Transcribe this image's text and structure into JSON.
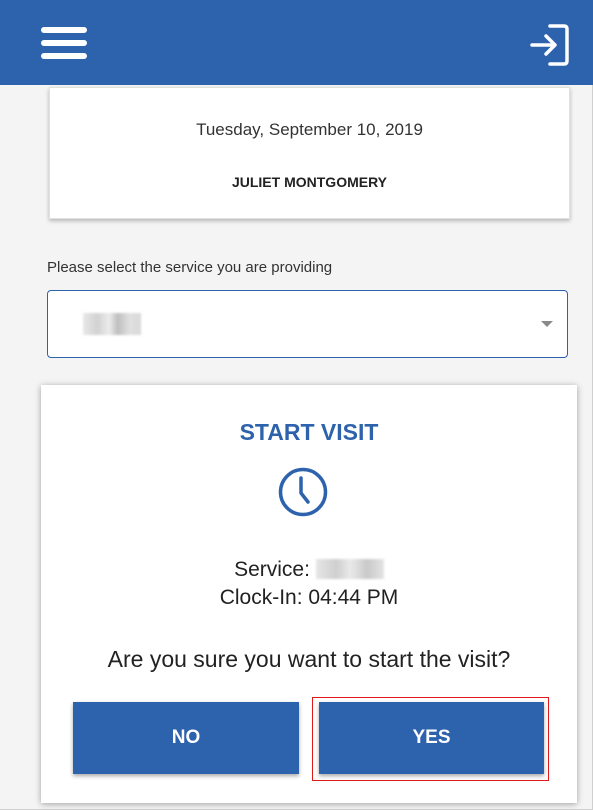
{
  "header": {
    "menu_icon": "hamburger-menu-icon",
    "logout_icon": "sign-out-icon",
    "background": "#2d62ad"
  },
  "visit_card": {
    "date": "Tuesday, September 10, 2019",
    "client_name": "JULIET MONTGOMERY"
  },
  "service_select": {
    "label": "Please select the service you are providing",
    "selected_value": "",
    "border_color": "#2d62ad"
  },
  "dialog": {
    "title": "START VISIT",
    "icon": "clock-icon",
    "service_label": "Service:",
    "service_value": "",
    "clock_in_text": "Clock-In: 04:44 PM",
    "question": "Are you sure you want to start the visit?",
    "no_label": "NO",
    "yes_label": "YES",
    "accent": "#2d62ad"
  },
  "highlight": {
    "target": "yes-button",
    "color": "#e01818"
  }
}
